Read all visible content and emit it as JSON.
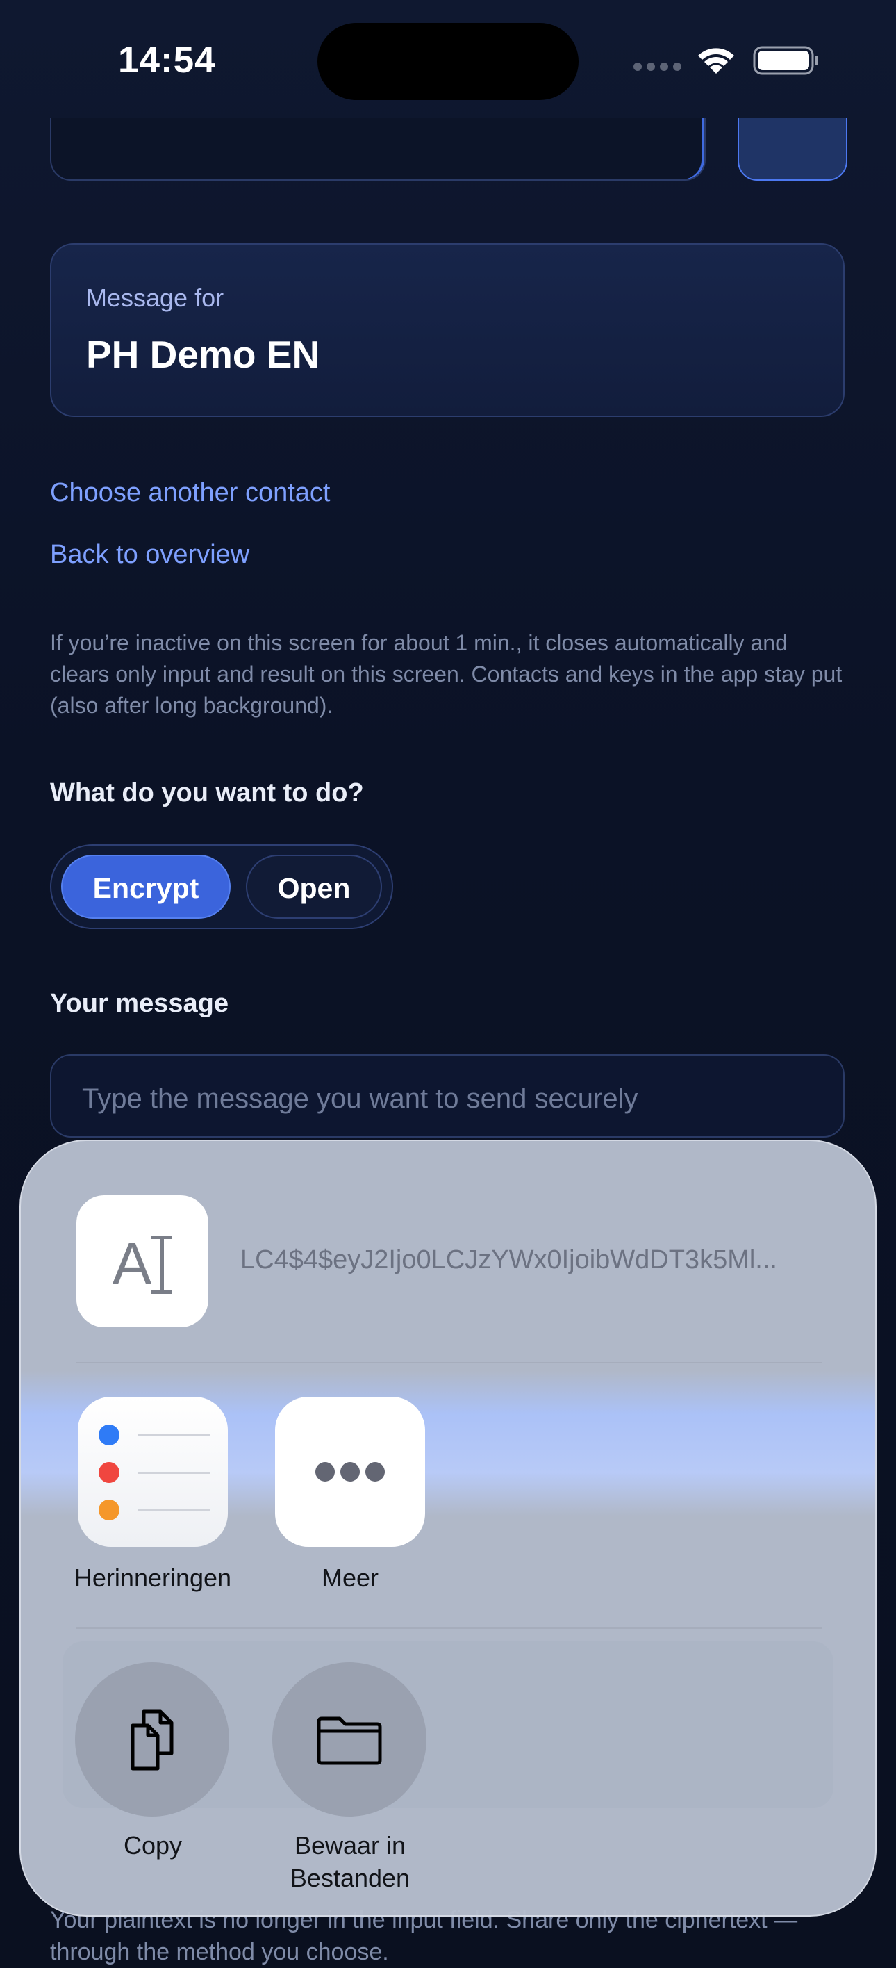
{
  "status_bar": {
    "time": "14:54",
    "icons": [
      "cellular-signal-icon",
      "wifi-icon",
      "battery-icon"
    ]
  },
  "contact_card": {
    "label": "Message for",
    "name": "PH Demo EN"
  },
  "links": {
    "choose_contact": "Choose another contact",
    "back_overview": "Back to overview"
  },
  "inactivity_note": "If you’re inactive on this screen for about 1 min., it closes automatically and clears only input and result on this screen. Contacts and keys in the app stay put (also after long background).",
  "mode": {
    "label": "What do you want to do?",
    "options": [
      "Encrypt",
      "Open"
    ],
    "selected": "Encrypt"
  },
  "message": {
    "label": "Your message",
    "placeholder": "Type the message you want to send securely"
  },
  "bottom_text": "Your plaintext is no longer in the input field. Share only the ciphertext — through the method you choose.",
  "share_sheet": {
    "preview_text": "LC4$4$eyJ2Ijo0LCJzYWx0IjoibWdDT3k5Ml...",
    "apps": [
      {
        "label": "Herinneringen",
        "icon": "reminders-icon"
      },
      {
        "label": "Meer",
        "icon": "more-icon"
      }
    ],
    "actions": [
      {
        "label": "Copy",
        "icon": "copy-icon"
      },
      {
        "label_line1": "Bewaar in",
        "label_line2": "Bestanden",
        "icon": "folder-icon"
      }
    ]
  },
  "colors": {
    "background": "#0a1020",
    "accent": "#3b64dc",
    "link": "#7ea0ff",
    "sheet": "#b6bece"
  }
}
